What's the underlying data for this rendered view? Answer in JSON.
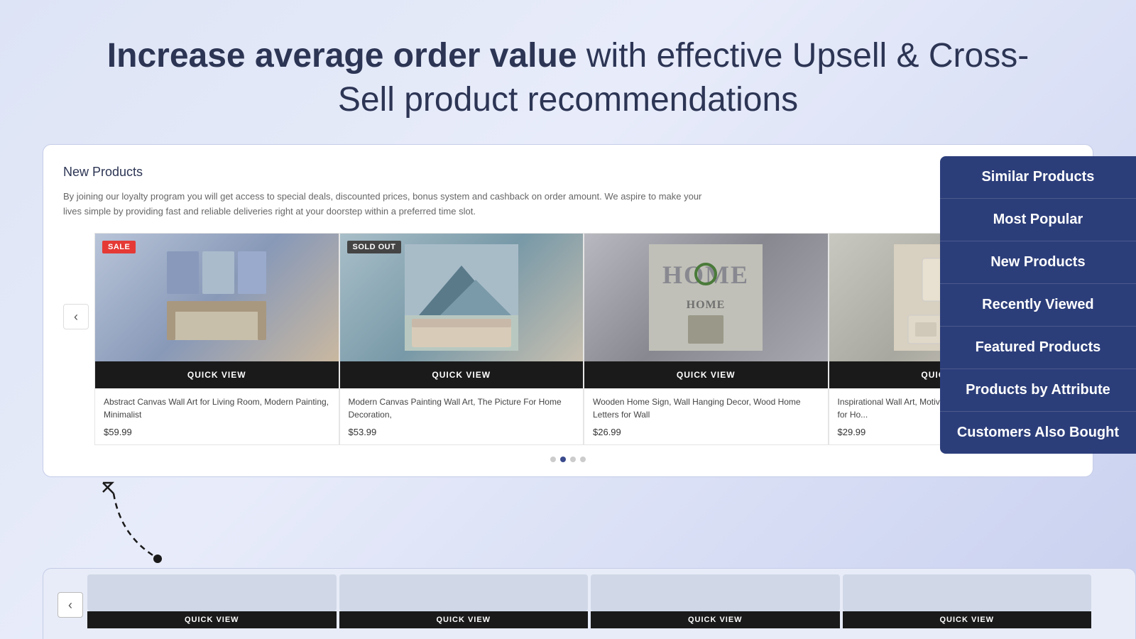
{
  "header": {
    "title_bold": "Increase average order value",
    "title_regular": " with effective Upsell & Cross-Sell product recommendations"
  },
  "card": {
    "title": "New Products",
    "description": "By joining our loyalty program you will get access to special deals, discounted prices, bonus system and cashback on order amount. We aspire to make your lives simple by providing fast and reliable deliveries right at your doorstep within a preferred time slot."
  },
  "products": [
    {
      "badge": "SALE",
      "badge_type": "sale",
      "name": "Abstract Canvas Wall Art for Living Room, Modern Painting, Minimalist",
      "price": "$59.99",
      "quick_view": "QUICK VIEW"
    },
    {
      "badge": "SOLD OUT",
      "badge_type": "sold",
      "name": "Modern Canvas Painting Wall Art, The Picture For Home Decoration,",
      "price": "$53.99",
      "quick_view": "QUICK VIEW"
    },
    {
      "badge": "",
      "badge_type": "",
      "name": "Wooden Home Sign, Wall Hanging Decor, Wood Home Letters for Wall",
      "price": "$26.99",
      "quick_view": "QUICK VIEW"
    },
    {
      "badge": "",
      "badge_type": "",
      "name": "Inspirational Wall Art, Motivatio... Wall Art, Positive Quotes for Ho...",
      "price": "$29.99",
      "quick_view": "QUICK VIEW"
    }
  ],
  "nav": {
    "prev": "‹",
    "next": "›"
  },
  "dots": [
    {
      "active": false
    },
    {
      "active": true
    },
    {
      "active": false
    },
    {
      "active": false
    }
  ],
  "side_tabs": [
    {
      "label": "Similar Products"
    },
    {
      "label": "Most Popular"
    },
    {
      "label": "New Products"
    },
    {
      "label": "Recently Viewed"
    },
    {
      "label": "Featured Products"
    },
    {
      "label": "Products by Attribute"
    },
    {
      "label": "Customers Also Bought"
    }
  ],
  "bottom_qv_labels": [
    "QUICK VIEW",
    "QUICK VIEW",
    "QUICK VIEW",
    "QUICK VIEW"
  ]
}
